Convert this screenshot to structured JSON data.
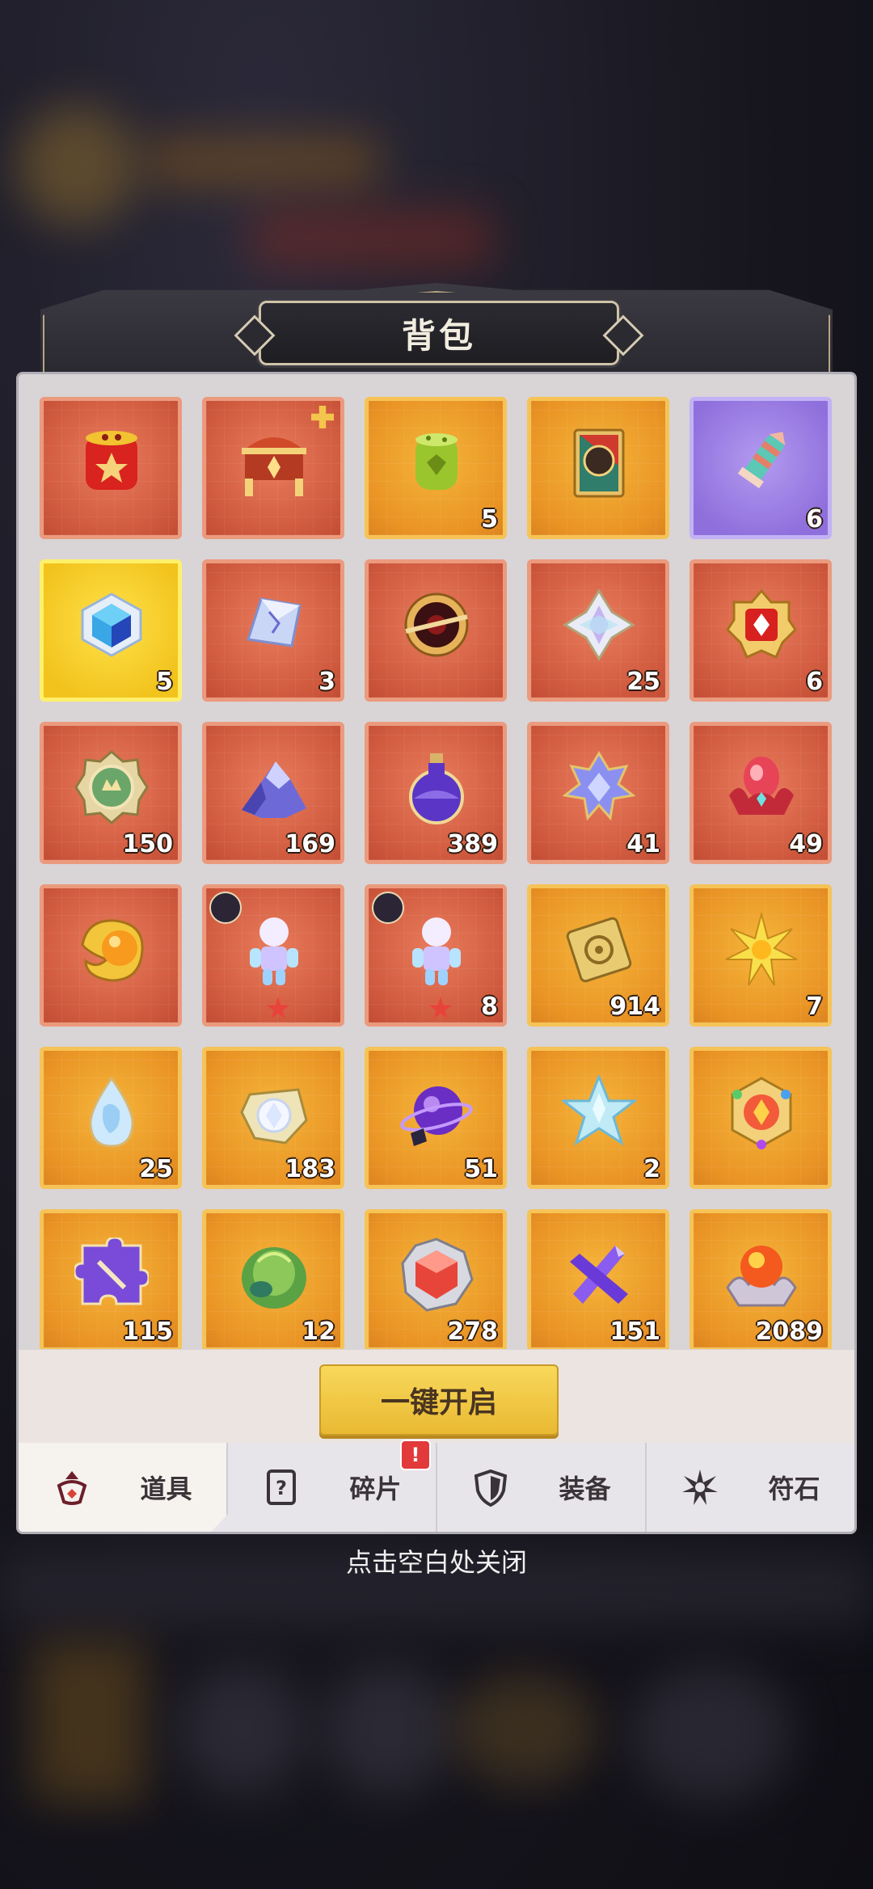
{
  "title": "背包",
  "items": [
    {
      "name": "red-lantern-icon",
      "rarity": "red",
      "count": ""
    },
    {
      "name": "treasure-chest-icon",
      "rarity": "red",
      "count": "",
      "plus": true
    },
    {
      "name": "green-firecracker-icon",
      "rarity": "gold",
      "count": "5"
    },
    {
      "name": "hero-card-icon",
      "rarity": "gold",
      "count": ""
    },
    {
      "name": "firework-rocket-icon",
      "rarity": "purple",
      "count": "6"
    },
    {
      "name": "blue-crystal-cube-icon",
      "rarity": "yellow",
      "count": "5"
    },
    {
      "name": "crystal-shard-icon",
      "rarity": "red",
      "count": "3"
    },
    {
      "name": "dark-orb-icon",
      "rarity": "red",
      "count": ""
    },
    {
      "name": "silver-star-gem-icon",
      "rarity": "red",
      "count": "25"
    },
    {
      "name": "red-badge-icon",
      "rarity": "red",
      "count": "6"
    },
    {
      "name": "green-medal-icon",
      "rarity": "red",
      "count": "150"
    },
    {
      "name": "purple-ore-icon",
      "rarity": "red",
      "count": "169"
    },
    {
      "name": "purple-potion-icon",
      "rarity": "red",
      "count": "389"
    },
    {
      "name": "blue-snowflake-gem-icon",
      "rarity": "red",
      "count": "41"
    },
    {
      "name": "red-crystal-flower-icon",
      "rarity": "red",
      "count": "49"
    },
    {
      "name": "gold-orb-icon",
      "rarity": "red",
      "count": ""
    },
    {
      "name": "hero-figure-icon",
      "rarity": "red",
      "count": "",
      "badge": true,
      "star": true
    },
    {
      "name": "hero-figure-icon",
      "rarity": "red",
      "count": "8",
      "badge": true,
      "star": true
    },
    {
      "name": "gold-scroll-icon",
      "rarity": "gold",
      "count": "914"
    },
    {
      "name": "gold-sun-icon",
      "rarity": "gold",
      "count": "7"
    },
    {
      "name": "water-drop-gem-icon",
      "rarity": "gold",
      "count": "25"
    },
    {
      "name": "white-diamond-icon",
      "rarity": "gold",
      "count": "183"
    },
    {
      "name": "purple-planet-icon",
      "rarity": "gold",
      "count": "51"
    },
    {
      "name": "ice-star-icon",
      "rarity": "gold",
      "count": "2"
    },
    {
      "name": "rainbow-emblem-icon",
      "rarity": "gold",
      "count": ""
    },
    {
      "name": "puzzle-piece-icon",
      "rarity": "gold",
      "count": "115"
    },
    {
      "name": "green-cabbage-icon",
      "rarity": "gold",
      "count": "12"
    },
    {
      "name": "red-gem-icon",
      "rarity": "gold",
      "count": "278"
    },
    {
      "name": "purple-crystal-cross-icon",
      "rarity": "gold",
      "count": "151"
    },
    {
      "name": "fire-orb-icon",
      "rarity": "gold",
      "count": "2089"
    }
  ],
  "open_all_label": "一键开启",
  "tabs": [
    {
      "label": "道具",
      "icon": "bag-icon",
      "active": true,
      "alert": false
    },
    {
      "label": "碎片",
      "icon": "question-card-icon",
      "active": false,
      "alert": true,
      "alert_text": "!"
    },
    {
      "label": "装备",
      "icon": "shield-icon",
      "active": false,
      "alert": false
    },
    {
      "label": "符石",
      "icon": "rune-star-icon",
      "active": false,
      "alert": false
    }
  ],
  "close_hint": "点击空白处关闭"
}
